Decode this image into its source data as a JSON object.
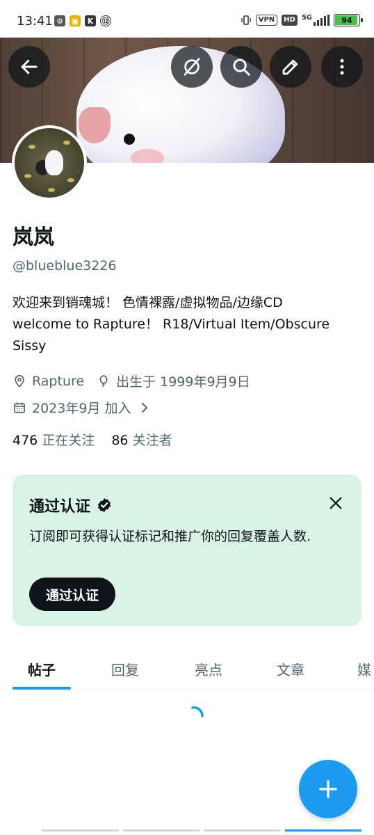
{
  "status_bar": {
    "time": "13:41",
    "vpn": "VPN",
    "hd": "HD",
    "network": "5G",
    "battery": "94"
  },
  "banner": {
    "back_icon": "arrow-left-icon",
    "actions": [
      "no-link-icon",
      "search-icon",
      "edit-icon",
      "more-vertical-icon"
    ]
  },
  "profile": {
    "name": "岚岚",
    "handle": "@blueblue3226",
    "bio_line1": "欢迎来到销魂城！ 色情裸露/虚拟物品/边缘CD",
    "bio_line2": "welcome to Rapture！ R18/Virtual Item/Obscure Sissy",
    "location": "Rapture",
    "birthday": "出生于 1999年9月9日",
    "joined": "2023年9月 加入",
    "following_count": "476",
    "following_label": "正在关注",
    "followers_count": "86",
    "followers_label": "关注者"
  },
  "verify_card": {
    "title": "通过认证",
    "description": "订阅即可获得认证标记和推广你的回复覆盖人数.",
    "button": "通过认证",
    "bg_color": "#d9f3e6"
  },
  "tabs": {
    "items": [
      "帖子",
      "回复",
      "亮点",
      "文章",
      "媒"
    ],
    "active": "帖子"
  },
  "colors": {
    "accent": "#1d9bf0",
    "text": "#0f1419",
    "secondary": "#536471"
  }
}
